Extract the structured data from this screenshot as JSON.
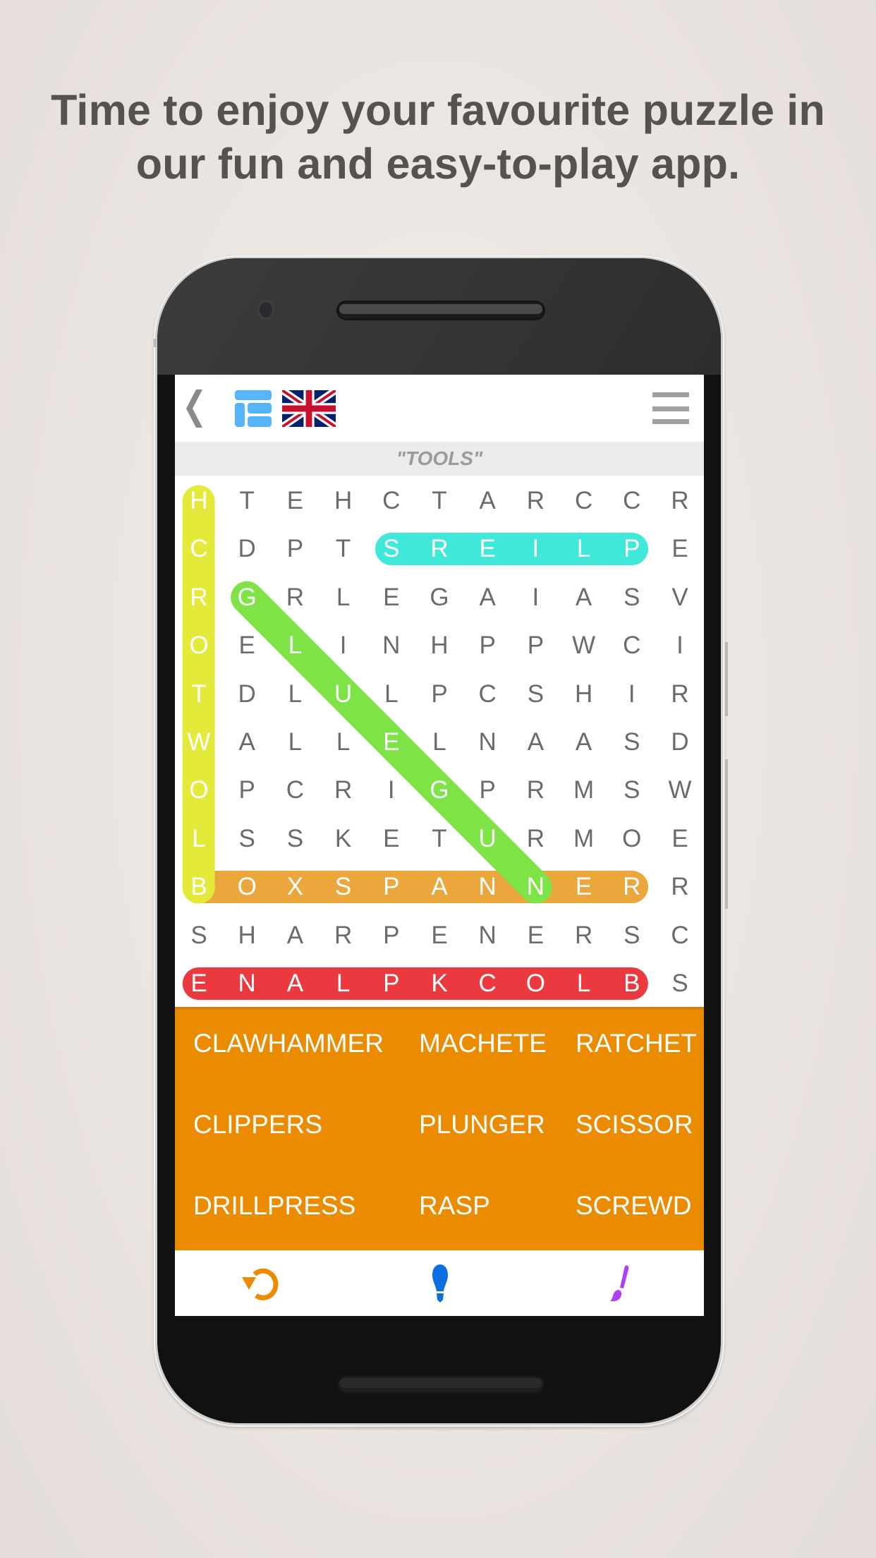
{
  "promo": {
    "headline_line1": "Time to enjoy your favourite puzzle in",
    "headline_line2": "our fun and easy-to-play app."
  },
  "app": {
    "topbar": {
      "back_icon": "chevron-left-icon",
      "layout_icon": "grid-layout-icon",
      "language_flag": "uk-flag-icon",
      "menu_icon": "hamburger-menu-icon"
    },
    "category": "\"TOOLS\"",
    "grid": {
      "rows": [
        [
          "H",
          "T",
          "E",
          "H",
          "C",
          "T",
          "A",
          "R",
          "C",
          "C",
          "R"
        ],
        [
          "C",
          "D",
          "P",
          "T",
          "S",
          "R",
          "E",
          "I",
          "L",
          "P",
          "E"
        ],
        [
          "R",
          "G",
          "R",
          "L",
          "E",
          "G",
          "A",
          "I",
          "A",
          "S",
          "V"
        ],
        [
          "O",
          "E",
          "L",
          "I",
          "N",
          "H",
          "P",
          "P",
          "W",
          "C",
          "I"
        ],
        [
          "T",
          "D",
          "L",
          "U",
          "L",
          "P",
          "C",
          "S",
          "H",
          "I",
          "R"
        ],
        [
          "W",
          "A",
          "L",
          "L",
          "E",
          "L",
          "N",
          "A",
          "A",
          "S",
          "D"
        ],
        [
          "O",
          "P",
          "C",
          "R",
          "I",
          "G",
          "P",
          "R",
          "M",
          "S",
          "W"
        ],
        [
          "L",
          "S",
          "S",
          "K",
          "E",
          "T",
          "U",
          "R",
          "M",
          "O",
          "E"
        ],
        [
          "B",
          "O",
          "X",
          "S",
          "P",
          "A",
          "N",
          "N",
          "E",
          "R",
          "R"
        ],
        [
          "S",
          "H",
          "A",
          "R",
          "P",
          "E",
          "N",
          "E",
          "R",
          "S",
          "C"
        ],
        [
          "E",
          "N",
          "A",
          "L",
          "P",
          "K",
          "C",
          "O",
          "L",
          "B",
          "S"
        ]
      ],
      "found_words": [
        {
          "word": "BLOWTORCH",
          "start": [
            8,
            0
          ],
          "end": [
            0,
            0
          ],
          "color": "#e4ea3a"
        },
        {
          "word": "PLIERS",
          "start": [
            1,
            9
          ],
          "end": [
            1,
            4
          ],
          "color": "#40e8da"
        },
        {
          "word": "BOXSPANNER",
          "start": [
            8,
            0
          ],
          "end": [
            8,
            9
          ],
          "color": "#eba63c"
        },
        {
          "word": "BLOCKPLANE",
          "start": [
            10,
            9
          ],
          "end": [
            10,
            0
          ],
          "color": "#ea3a40"
        },
        {
          "word": "GLUEGUN",
          "start": [
            2,
            1
          ],
          "end": [
            8,
            7
          ],
          "color": "#7de346"
        }
      ]
    },
    "word_list": [
      [
        "CLAWHAMMER",
        "MACHETE",
        "RATCHET"
      ],
      [
        "CLIPPERS",
        "PLUNGER",
        "SCISSOR"
      ],
      [
        "DRILLPRESS",
        "RASP",
        "SCREWD"
      ]
    ],
    "bottom_bar": {
      "restart_icon": "restart-icon",
      "hint_icon": "lightbulb-icon",
      "theme_icon": "paintbrush-icon"
    },
    "colors": {
      "word_list_bg": "#eb8c00",
      "restart": "#eb8c00",
      "hint": "#0a6fe0",
      "theme": "#b040f0",
      "layout_icon": "#55b4fa"
    }
  }
}
